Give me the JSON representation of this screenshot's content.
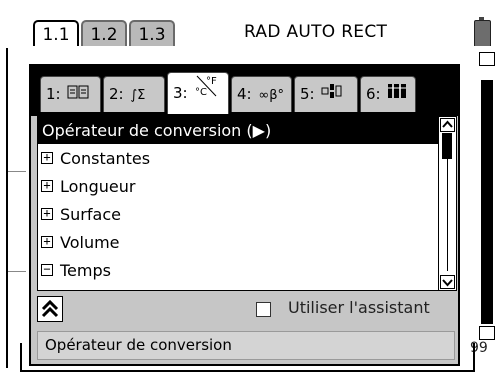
{
  "doc_tabs": [
    {
      "label": "1.1",
      "active": true
    },
    {
      "label": "1.2",
      "active": false
    },
    {
      "label": "1.3",
      "active": false
    }
  ],
  "status": {
    "mode_text": "RAD AUTO RECT",
    "battery_icon": "battery-icon"
  },
  "background_doc": {
    "partial_value": "99"
  },
  "dialog": {
    "category_tabs": [
      {
        "num": "1:",
        "icon": "book-icon",
        "glyph": "📖",
        "active": false
      },
      {
        "num": "2:",
        "icon": "integral-sigma-icon",
        "glyph": "∫Σ",
        "active": false
      },
      {
        "num": "3:",
        "icon": "units-icon",
        "glyph": "°C°F",
        "active": true
      },
      {
        "num": "4:",
        "icon": "infinity-beta-icon",
        "glyph": "∞β°",
        "active": false
      },
      {
        "num": "5:",
        "icon": "template-icon",
        "glyph": "▭▯",
        "active": false
      },
      {
        "num": "6:",
        "icon": "library-icon",
        "glyph": "▮▮▮",
        "active": false
      }
    ],
    "list": {
      "header": "Opérateur de conversion (▶)",
      "items": [
        {
          "label": "Constantes",
          "expander": "+"
        },
        {
          "label": "Longueur",
          "expander": "+"
        },
        {
          "label": "Surface",
          "expander": "+"
        },
        {
          "label": "Volume",
          "expander": "+"
        },
        {
          "label": "Temps",
          "expander": "−"
        }
      ]
    },
    "wizard_label": "Utiliser l'assistant",
    "wizard_checked": false,
    "help_text": "Opérateur de conversion"
  },
  "colors": {
    "dialog_bg": "#c6c6c6",
    "tab_inactive": "#b9b9b9",
    "selection": "#000000"
  }
}
